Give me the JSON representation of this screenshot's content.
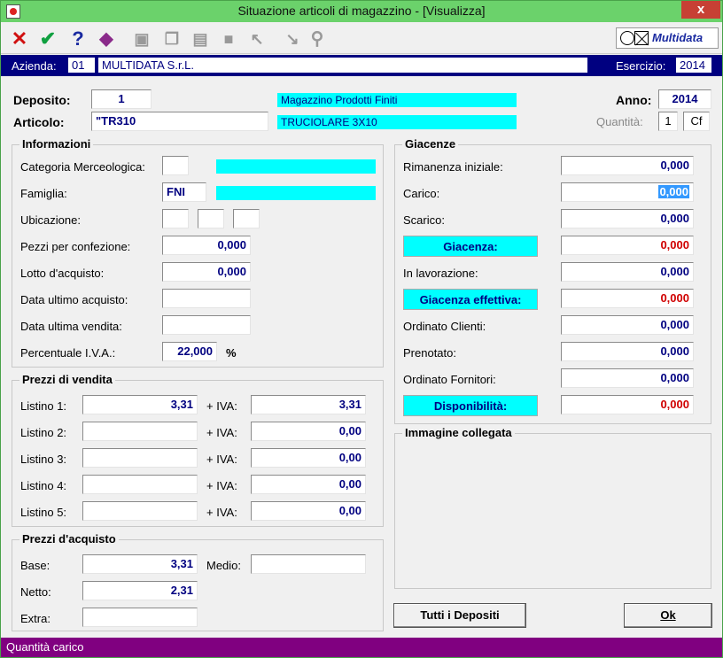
{
  "window": {
    "title": "Situazione articoli di magazzino - [Visualizza]",
    "close_label": "x"
  },
  "toolbar": {
    "brand": "Multidata"
  },
  "company": {
    "azienda_label": "Azienda:",
    "azienda_code": "01",
    "azienda_name": "MULTIDATA S.r.L.",
    "esercizio_label": "Esercizio:",
    "esercizio_value": "2014"
  },
  "header": {
    "deposito_label": "Deposito:",
    "deposito_value": "1",
    "deposito_desc": "Magazzino Prodotti Finiti",
    "articolo_label": "Articolo:",
    "articolo_value": "\"TR310",
    "articolo_desc": "TRUCIOLARE 3X10",
    "anno_label": "Anno:",
    "anno_value": "2014",
    "quantita_label": "Quantità:",
    "quantita_value": "1",
    "quantita_unit": "Cf"
  },
  "informazioni": {
    "title": "Informazioni",
    "categoria_label": "Categoria Merceologica:",
    "categoria_value": "",
    "famiglia_label": "Famiglia:",
    "famiglia_value": "FNI",
    "ubicazione_label": "Ubicazione:",
    "pezzi_label": "Pezzi per confezione:",
    "pezzi_value": "0,000",
    "lotto_label": "Lotto d'acquisto:",
    "lotto_value": "0,000",
    "data_acquisto_label": "Data ultimo acquisto:",
    "data_acquisto_value": "",
    "data_vendita_label": "Data ultima vendita:",
    "data_vendita_value": "",
    "iva_label": "Percentuale I.V.A.:",
    "iva_value": "22,000",
    "iva_unit": "%"
  },
  "prezzi_vendita": {
    "title": "Prezzi di vendita",
    "iva_label": "+ IVA:",
    "rows": [
      {
        "label": "Listino 1:",
        "price": "3,31",
        "iva": "3,31"
      },
      {
        "label": "Listino 2:",
        "price": "",
        "iva": "0,00"
      },
      {
        "label": "Listino 3:",
        "price": "",
        "iva": "0,00"
      },
      {
        "label": "Listino 4:",
        "price": "",
        "iva": "0,00"
      },
      {
        "label": "Listino 5:",
        "price": "",
        "iva": "0,00"
      }
    ]
  },
  "prezzi_acquisto": {
    "title": "Prezzi d'acquisto",
    "base_label": "Base:",
    "base_value": "3,31",
    "medio_label": "Medio:",
    "medio_value": "",
    "netto_label": "Netto:",
    "netto_value": "2,31",
    "extra_label": "Extra:",
    "extra_value": ""
  },
  "giacenze": {
    "title": "Giacenze",
    "rimanenza_label": "Rimanenza iniziale:",
    "rimanenza_value": "0,000",
    "carico_label": "Carico:",
    "carico_value": "0,000",
    "scarico_label": "Scarico:",
    "scarico_value": "0,000",
    "giacenza_label": "Giacenza:",
    "giacenza_value": "0,000",
    "lavorazione_label": "In lavorazione:",
    "lavorazione_value": "0,000",
    "effettiva_label": "Giacenza effettiva:",
    "effettiva_value": "0,000",
    "ordinato_clienti_label": "Ordinato Clienti:",
    "ordinato_clienti_value": "0,000",
    "prenotato_label": "Prenotato:",
    "prenotato_value": "0,000",
    "ordinato_fornitori_label": "Ordinato Fornitori:",
    "ordinato_fornitori_value": "0,000",
    "disponibilita_label": "Disponibilità:",
    "disponibilita_value": "0,000"
  },
  "immagine": {
    "title": "Immagine collegata"
  },
  "buttons": {
    "tutti_label": "Tutti i Depositi",
    "ok_label": "Ok"
  },
  "status": {
    "text": "Quantità carico"
  },
  "colors": {
    "title_bar": "#6bd26b",
    "company_bar": "#000080",
    "status_bar": "#800080",
    "highlight": "#00ffff",
    "alert_value": "#d00000"
  }
}
